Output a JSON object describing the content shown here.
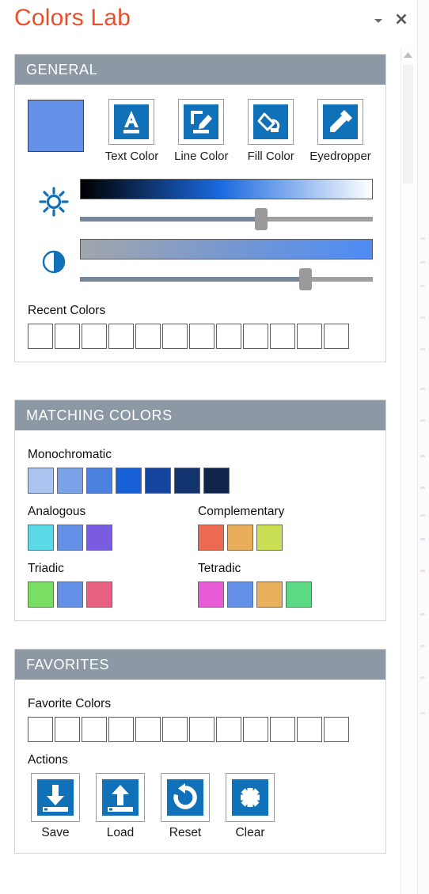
{
  "pane": {
    "title": "Colors Lab",
    "title_color": "#e8502a",
    "dropdown_icon": "chevron-down-icon",
    "close_icon": "close-icon"
  },
  "accent": {
    "icon_blue": "#1071b8",
    "header_gray": "#8c98a4",
    "current_color": "#6490e8"
  },
  "scrollbar": {
    "up_arrow_icon": "scroll-up-arrow-icon"
  },
  "general": {
    "header": "GENERAL",
    "current_color_value": "#6490e8",
    "tools": [
      {
        "label": "Text Color",
        "icon": "text-color-icon"
      },
      {
        "label": "Line Color",
        "icon": "line-color-icon"
      },
      {
        "label": "Fill Color",
        "icon": "fill-color-icon"
      },
      {
        "label": "Eyedropper",
        "icon": "eyedropper-icon"
      }
    ],
    "brightness": {
      "icon": "brightness-sun-icon",
      "gradient_from": "#000000",
      "gradient_mid": "#1a6ae0",
      "gradient_to": "#ffffff",
      "value": 62
    },
    "contrast": {
      "icon": "contrast-half-circle-icon",
      "gradient_from": "#a2a6ac",
      "gradient_to": "#4d8bf5",
      "value": 77
    },
    "recent_colors_label": "Recent Colors",
    "recent_colors": [
      "",
      "",
      "",
      "",
      "",
      "",
      "",
      "",
      "",
      "",
      "",
      ""
    ]
  },
  "matching": {
    "header": "MATCHING COLORS",
    "groups": [
      {
        "label": "Monochromatic",
        "colors": [
          "#aac4ef",
          "#7ba2e8",
          "#4d81e0",
          "#175fd6",
          "#16459f",
          "#12356f",
          "#0e2449"
        ]
      },
      {
        "label": "Analogous",
        "colors": [
          "#5cd9e6",
          "#6490e8",
          "#7a5ce0"
        ]
      },
      {
        "label": "Complementary",
        "colors": [
          "#ec6a52",
          "#e8ad58",
          "#cbdf55"
        ]
      },
      {
        "label": "Triadic",
        "colors": [
          "#7ade63",
          "#6490e8",
          "#e8607f"
        ]
      },
      {
        "label": "Tetradic",
        "colors": [
          "#e85ad6",
          "#6490e8",
          "#e8b05c",
          "#5cd983"
        ]
      }
    ]
  },
  "favorites": {
    "header": "FAVORITES",
    "favorite_colors_label": "Favorite Colors",
    "favorite_colors": [
      "",
      "",
      "",
      "",
      "",
      "",
      "",
      "",
      "",
      "",
      "",
      ""
    ],
    "actions_label": "Actions",
    "actions": [
      {
        "label": "Save",
        "icon": "save-download-icon"
      },
      {
        "label": "Load",
        "icon": "load-upload-icon"
      },
      {
        "label": "Reset",
        "icon": "reset-undo-icon"
      },
      {
        "label": "Clear",
        "icon": "clear-x-icon"
      }
    ]
  }
}
